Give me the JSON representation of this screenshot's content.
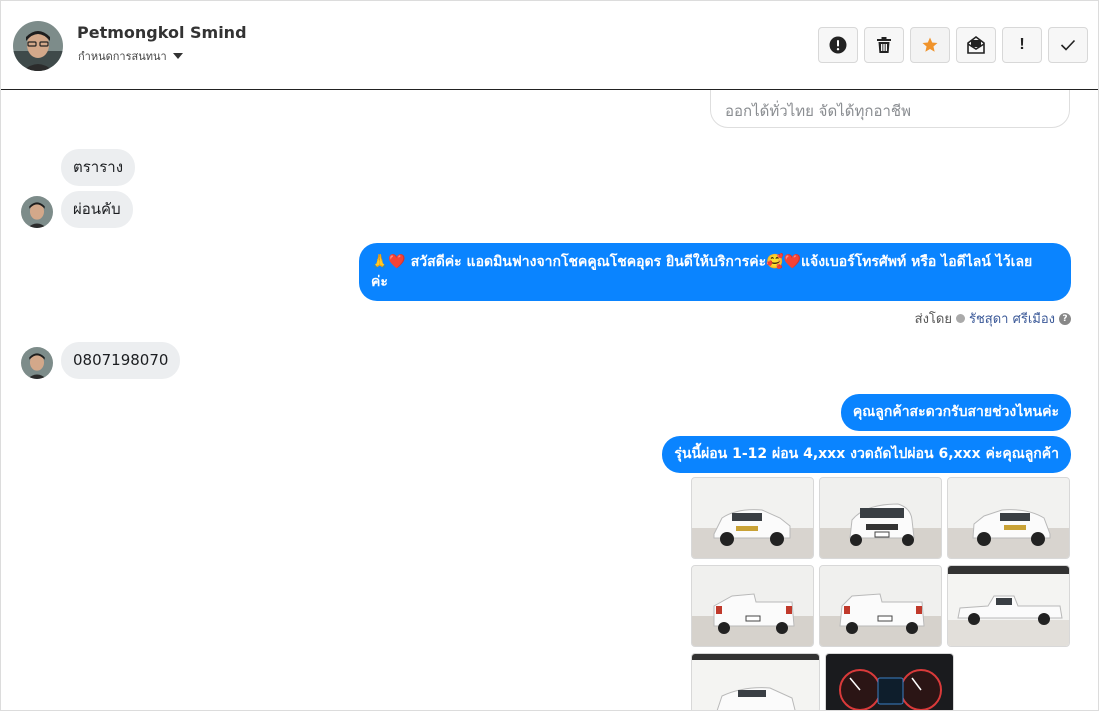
{
  "header": {
    "contact_name": "Petmongkol Smind",
    "subtitle": "กำหนดการสนทนา",
    "toolbar": [
      {
        "icon": "alert-circle-icon",
        "tooltip": ""
      },
      {
        "icon": "trash-icon",
        "tooltip": ""
      },
      {
        "icon": "star-icon",
        "tooltip": ""
      },
      {
        "icon": "envelope-open-icon",
        "tooltip": ""
      },
      {
        "icon": "exclamation-icon",
        "label": "!"
      },
      {
        "icon": "check-icon",
        "tooltip": ""
      }
    ]
  },
  "chat": {
    "previous_card_text": "ออกได้ทั่วไทย จัดได้ทุกอาชีพ",
    "messages": [
      {
        "from": "customer",
        "text": "ตราราง"
      },
      {
        "from": "customer",
        "text": "ผ่อนคับ"
      },
      {
        "from": "page",
        "line1": "🙏❤️ สวัสดีค่ะ แอดมินฟางจากโชคคูณโชคอุดร ยินดีให้บริการค่ะ🥰❤️แจ้งเบอร์โทรศัพท์ หรือ ไอดีไลน์  ไว้เลย",
        "line2": "ค่ะ"
      },
      {
        "from": "customer",
        "text": "0807198070"
      },
      {
        "from": "page",
        "text": "คุณลูกค้าสะดวกรับสายช่วงไหนค่ะ"
      },
      {
        "from": "page",
        "text": "รุ่นนี้ผ่อน 1-12 ผ่อน 4,xxx งวดถัดไปผ่อน 6,xxx ค่ะคุณลูกค้า"
      }
    ],
    "sent_by": {
      "label": "ส่งโดย",
      "agent": "รัชสุดา ศรีเมือง",
      "help": "?"
    }
  },
  "photos": [
    {
      "alt": "white pickup front-left"
    },
    {
      "alt": "white pickup front"
    },
    {
      "alt": "white pickup front-right"
    },
    {
      "alt": "white pickup rear-left"
    },
    {
      "alt": "white pickup rear"
    },
    {
      "alt": "white pickup side"
    },
    {
      "alt": "white pickup showroom"
    },
    {
      "alt": "dashboard gauges"
    }
  ],
  "colors": {
    "outgoing_bubble": "#0a84ff",
    "incoming_bubble": "#eceef0",
    "star": "#f0932b"
  }
}
